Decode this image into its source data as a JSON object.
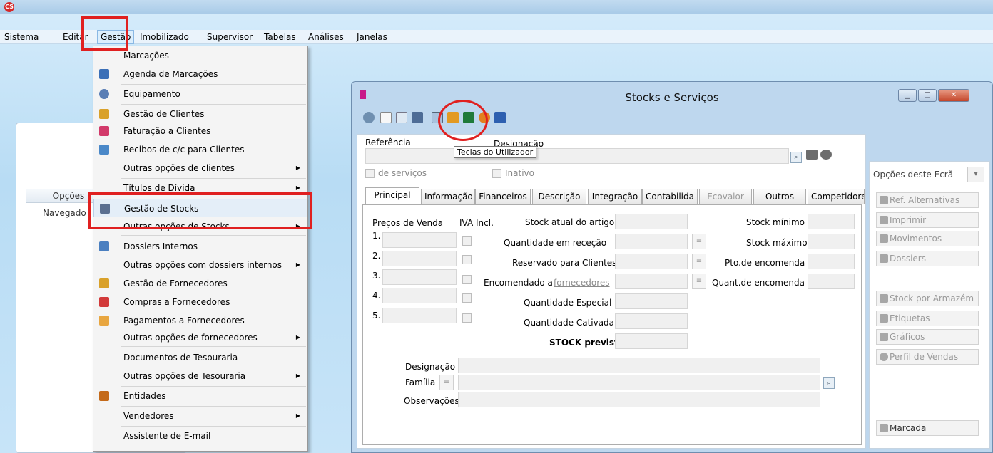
{
  "menubar": {
    "items": [
      "Sistema",
      "Editar",
      "Gestão",
      "Imobilizado",
      "Supervisor",
      "Tabelas",
      "Análises",
      "Janelas"
    ]
  },
  "background": {
    "options_header": "Opções",
    "navigator": "Navegado"
  },
  "gestao_menu": {
    "items": [
      {
        "label": "Marcações"
      },
      {
        "label": "Agenda de Marcações"
      },
      {
        "label": "Equipamento"
      },
      {
        "label": "Gestão de Clientes"
      },
      {
        "label": "Faturação a Clientes"
      },
      {
        "label": "Recibos de c/c para Clientes"
      },
      {
        "label": "Outras opções de clientes"
      },
      {
        "label": "Títulos de Dívida"
      },
      {
        "label": "Gestão de Stocks"
      },
      {
        "label": "Outras opções de Stocks"
      },
      {
        "label": "Dossiers Internos"
      },
      {
        "label": "Outras opções com dossiers internos"
      },
      {
        "label": "Gestão de Fornecedores"
      },
      {
        "label": "Compras a Fornecedores"
      },
      {
        "label": "Pagamentos a Fornecedores"
      },
      {
        "label": "Outras opções de fornecedores"
      },
      {
        "label": "Documentos de Tesouraria"
      },
      {
        "label": "Outras opções de Tesouraria"
      },
      {
        "label": "Entidades"
      },
      {
        "label": "Vendedores"
      },
      {
        "label": "Assistente de E-mail"
      }
    ],
    "arrow": "▶"
  },
  "window": {
    "title": "Stocks e Serviços",
    "tooltip": "Teclas do Utilizador",
    "referencia_label": "Referência",
    "designacao_label": "Designação",
    "de_servicos": "de serviços",
    "inativo": "Inativo",
    "tabs": [
      "Principal",
      "Informação",
      "Financeiros",
      "Descrição",
      "Integração",
      "Contabilida",
      "Ecovalor",
      "Outros",
      "Competidore"
    ],
    "precos_de_venda": "Preços de Venda",
    "iva_incl": "IVA Incl.",
    "price_rows": [
      "1.",
      "2.",
      "3.",
      "4.",
      "5."
    ],
    "stock_labels": {
      "atual": "Stock atual do artigo",
      "rececao": "Quantidade em receção",
      "reservado": "Reservado para Clientes",
      "encomendado_a": "Encomendado a",
      "fornecedores": "fornecedores",
      "especial": "Quantidade Especial",
      "cativada": "Quantidade Cativada",
      "previsto": "STOCK previsto"
    },
    "right_labels": {
      "minimo": "Stock mínimo",
      "maximo": "Stock máximo",
      "pto": "Pto.de encomenda",
      "quant": "Quant.de encomenda"
    },
    "bottom_labels": {
      "designacao": "Designação",
      "familia": "Família",
      "observacoes": "Observações"
    },
    "options": {
      "title": "Opções deste Ecrã",
      "buttons_top": [
        "Ref. Alternativas",
        "Imprimir",
        "Movimentos",
        "Dossiers"
      ],
      "buttons_mid": [
        "Stock por Armazém",
        "Etiquetas",
        "Gráficos",
        "Perfil de Vendas"
      ],
      "marcada": "Marcada"
    },
    "controls": {
      "minimize": "▁",
      "maximize": "□",
      "close": "✕"
    }
  },
  "colors": {
    "highlight": "#e02020",
    "accent": "#c81a8a"
  }
}
